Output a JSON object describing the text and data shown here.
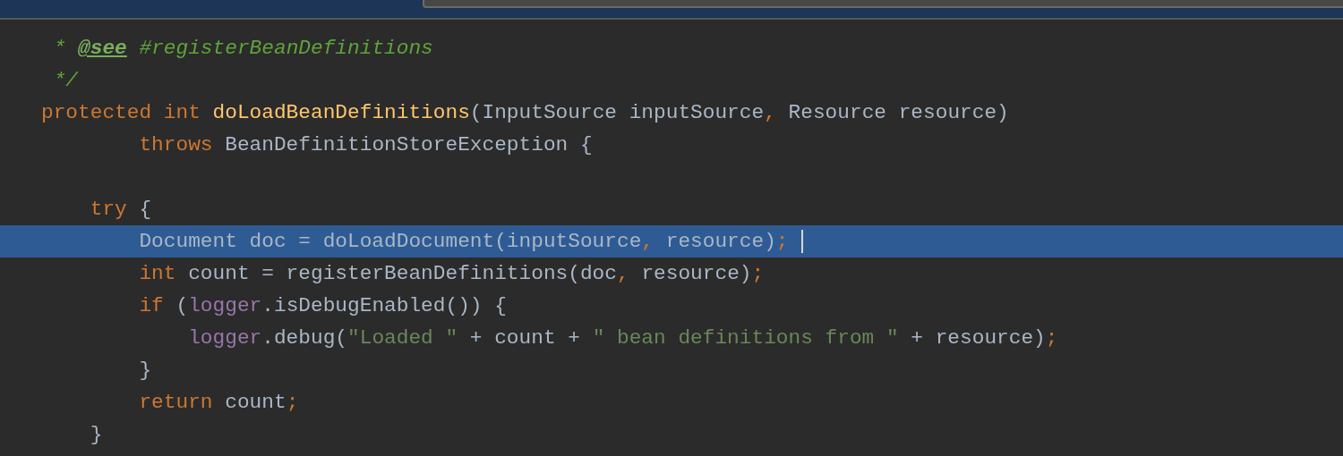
{
  "editor": {
    "lines": [
      {
        "selected": false
      },
      {
        "selected": false,
        "tokens": [
          {
            "text": " * ",
            "kind": "comment"
          },
          {
            "text": "@see",
            "kind": "doctag"
          },
          {
            "text": " #registerBeanDefinitions",
            "kind": "comment"
          }
        ]
      },
      {
        "selected": false,
        "tokens": [
          {
            "text": " */",
            "kind": "comment"
          }
        ]
      },
      {
        "selected": false,
        "tokens": [
          {
            "text": "protected int ",
            "kind": "keyword"
          },
          {
            "text": "doLoadBeanDefinitions",
            "kind": "method"
          },
          {
            "text": "(InputSource inputSource",
            "kind": "plain"
          },
          {
            "text": ", ",
            "kind": "keyword"
          },
          {
            "text": "Resource resource)",
            "kind": "plain"
          }
        ]
      },
      {
        "selected": false,
        "tokens": [
          {
            "text": "        throws ",
            "kind": "keyword"
          },
          {
            "text": "BeanDefinitionStoreException {",
            "kind": "plain"
          }
        ]
      },
      {
        "selected": false
      },
      {
        "selected": false,
        "tokens": [
          {
            "text": "    try ",
            "kind": "keyword"
          },
          {
            "text": "{",
            "kind": "plain"
          }
        ]
      },
      {
        "selected": true,
        "caret": true,
        "tokens": [
          {
            "text": "        Document doc = doLoadDocument(inputSource",
            "kind": "plain"
          },
          {
            "text": ", ",
            "kind": "keyword"
          },
          {
            "text": "resource)",
            "kind": "plain"
          },
          {
            "text": ";",
            "kind": "keyword"
          }
        ]
      },
      {
        "selected": false,
        "tokens": [
          {
            "text": "        int ",
            "kind": "keyword"
          },
          {
            "text": "count = registerBeanDefinitions(doc",
            "kind": "plain"
          },
          {
            "text": ", ",
            "kind": "keyword"
          },
          {
            "text": "resource)",
            "kind": "plain"
          },
          {
            "text": ";",
            "kind": "keyword"
          }
        ]
      },
      {
        "selected": false,
        "tokens": [
          {
            "text": "        if ",
            "kind": "keyword"
          },
          {
            "text": "(",
            "kind": "plain"
          },
          {
            "text": "logger",
            "kind": "field"
          },
          {
            "text": ".isDebugEnabled()) {",
            "kind": "plain"
          }
        ]
      },
      {
        "selected": false,
        "tokens": [
          {
            "text": "            logger",
            "kind": "field"
          },
          {
            "text": ".debug(",
            "kind": "plain"
          },
          {
            "text": "\"Loaded \"",
            "kind": "string"
          },
          {
            "text": " + count + ",
            "kind": "plain"
          },
          {
            "text": "\" bean definitions from \"",
            "kind": "string"
          },
          {
            "text": " + resource)",
            "kind": "plain"
          },
          {
            "text": ";",
            "kind": "keyword"
          }
        ]
      },
      {
        "selected": false,
        "tokens": [
          {
            "text": "        }",
            "kind": "plain"
          }
        ]
      },
      {
        "selected": false,
        "tokens": [
          {
            "text": "        return ",
            "kind": "keyword"
          },
          {
            "text": "count",
            "kind": "plain"
          },
          {
            "text": ";",
            "kind": "keyword"
          }
        ]
      },
      {
        "selected": false,
        "tokens": [
          {
            "text": "    }",
            "kind": "plain"
          }
        ]
      }
    ]
  }
}
